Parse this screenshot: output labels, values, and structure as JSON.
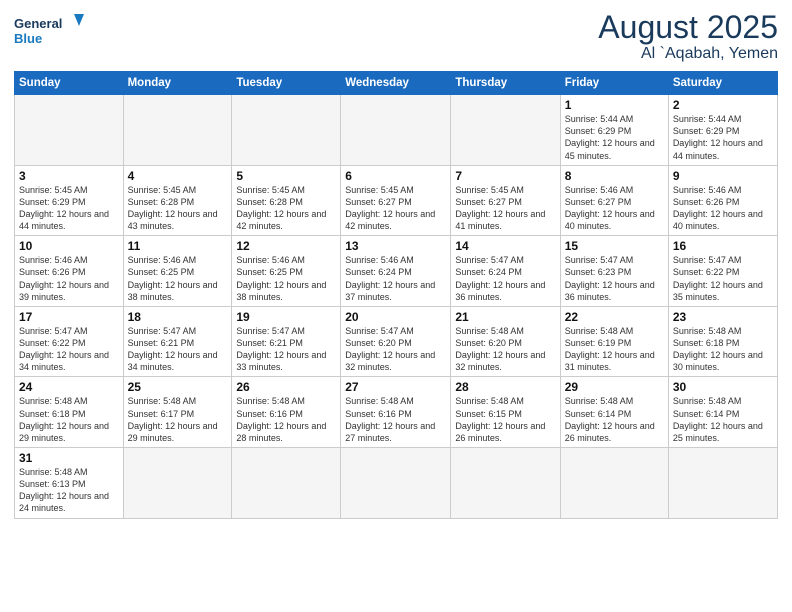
{
  "header": {
    "logo_general": "General",
    "logo_blue": "Blue",
    "month_year": "August 2025",
    "location": "Al `Aqabah, Yemen"
  },
  "weekdays": [
    "Sunday",
    "Monday",
    "Tuesday",
    "Wednesday",
    "Thursday",
    "Friday",
    "Saturday"
  ],
  "weeks": [
    [
      {
        "day": "",
        "info": ""
      },
      {
        "day": "",
        "info": ""
      },
      {
        "day": "",
        "info": ""
      },
      {
        "day": "",
        "info": ""
      },
      {
        "day": "",
        "info": ""
      },
      {
        "day": "1",
        "info": "Sunrise: 5:44 AM\nSunset: 6:29 PM\nDaylight: 12 hours and 45 minutes."
      },
      {
        "day": "2",
        "info": "Sunrise: 5:44 AM\nSunset: 6:29 PM\nDaylight: 12 hours and 44 minutes."
      }
    ],
    [
      {
        "day": "3",
        "info": "Sunrise: 5:45 AM\nSunset: 6:29 PM\nDaylight: 12 hours and 44 minutes."
      },
      {
        "day": "4",
        "info": "Sunrise: 5:45 AM\nSunset: 6:28 PM\nDaylight: 12 hours and 43 minutes."
      },
      {
        "day": "5",
        "info": "Sunrise: 5:45 AM\nSunset: 6:28 PM\nDaylight: 12 hours and 42 minutes."
      },
      {
        "day": "6",
        "info": "Sunrise: 5:45 AM\nSunset: 6:27 PM\nDaylight: 12 hours and 42 minutes."
      },
      {
        "day": "7",
        "info": "Sunrise: 5:45 AM\nSunset: 6:27 PM\nDaylight: 12 hours and 41 minutes."
      },
      {
        "day": "8",
        "info": "Sunrise: 5:46 AM\nSunset: 6:27 PM\nDaylight: 12 hours and 40 minutes."
      },
      {
        "day": "9",
        "info": "Sunrise: 5:46 AM\nSunset: 6:26 PM\nDaylight: 12 hours and 40 minutes."
      }
    ],
    [
      {
        "day": "10",
        "info": "Sunrise: 5:46 AM\nSunset: 6:26 PM\nDaylight: 12 hours and 39 minutes."
      },
      {
        "day": "11",
        "info": "Sunrise: 5:46 AM\nSunset: 6:25 PM\nDaylight: 12 hours and 38 minutes."
      },
      {
        "day": "12",
        "info": "Sunrise: 5:46 AM\nSunset: 6:25 PM\nDaylight: 12 hours and 38 minutes."
      },
      {
        "day": "13",
        "info": "Sunrise: 5:46 AM\nSunset: 6:24 PM\nDaylight: 12 hours and 37 minutes."
      },
      {
        "day": "14",
        "info": "Sunrise: 5:47 AM\nSunset: 6:24 PM\nDaylight: 12 hours and 36 minutes."
      },
      {
        "day": "15",
        "info": "Sunrise: 5:47 AM\nSunset: 6:23 PM\nDaylight: 12 hours and 36 minutes."
      },
      {
        "day": "16",
        "info": "Sunrise: 5:47 AM\nSunset: 6:22 PM\nDaylight: 12 hours and 35 minutes."
      }
    ],
    [
      {
        "day": "17",
        "info": "Sunrise: 5:47 AM\nSunset: 6:22 PM\nDaylight: 12 hours and 34 minutes."
      },
      {
        "day": "18",
        "info": "Sunrise: 5:47 AM\nSunset: 6:21 PM\nDaylight: 12 hours and 34 minutes."
      },
      {
        "day": "19",
        "info": "Sunrise: 5:47 AM\nSunset: 6:21 PM\nDaylight: 12 hours and 33 minutes."
      },
      {
        "day": "20",
        "info": "Sunrise: 5:47 AM\nSunset: 6:20 PM\nDaylight: 12 hours and 32 minutes."
      },
      {
        "day": "21",
        "info": "Sunrise: 5:48 AM\nSunset: 6:20 PM\nDaylight: 12 hours and 32 minutes."
      },
      {
        "day": "22",
        "info": "Sunrise: 5:48 AM\nSunset: 6:19 PM\nDaylight: 12 hours and 31 minutes."
      },
      {
        "day": "23",
        "info": "Sunrise: 5:48 AM\nSunset: 6:18 PM\nDaylight: 12 hours and 30 minutes."
      }
    ],
    [
      {
        "day": "24",
        "info": "Sunrise: 5:48 AM\nSunset: 6:18 PM\nDaylight: 12 hours and 29 minutes."
      },
      {
        "day": "25",
        "info": "Sunrise: 5:48 AM\nSunset: 6:17 PM\nDaylight: 12 hours and 29 minutes."
      },
      {
        "day": "26",
        "info": "Sunrise: 5:48 AM\nSunset: 6:16 PM\nDaylight: 12 hours and 28 minutes."
      },
      {
        "day": "27",
        "info": "Sunrise: 5:48 AM\nSunset: 6:16 PM\nDaylight: 12 hours and 27 minutes."
      },
      {
        "day": "28",
        "info": "Sunrise: 5:48 AM\nSunset: 6:15 PM\nDaylight: 12 hours and 26 minutes."
      },
      {
        "day": "29",
        "info": "Sunrise: 5:48 AM\nSunset: 6:14 PM\nDaylight: 12 hours and 26 minutes."
      },
      {
        "day": "30",
        "info": "Sunrise: 5:48 AM\nSunset: 6:14 PM\nDaylight: 12 hours and 25 minutes."
      }
    ],
    [
      {
        "day": "31",
        "info": "Sunrise: 5:48 AM\nSunset: 6:13 PM\nDaylight: 12 hours and 24 minutes."
      },
      {
        "day": "",
        "info": ""
      },
      {
        "day": "",
        "info": ""
      },
      {
        "day": "",
        "info": ""
      },
      {
        "day": "",
        "info": ""
      },
      {
        "day": "",
        "info": ""
      },
      {
        "day": "",
        "info": ""
      }
    ]
  ]
}
